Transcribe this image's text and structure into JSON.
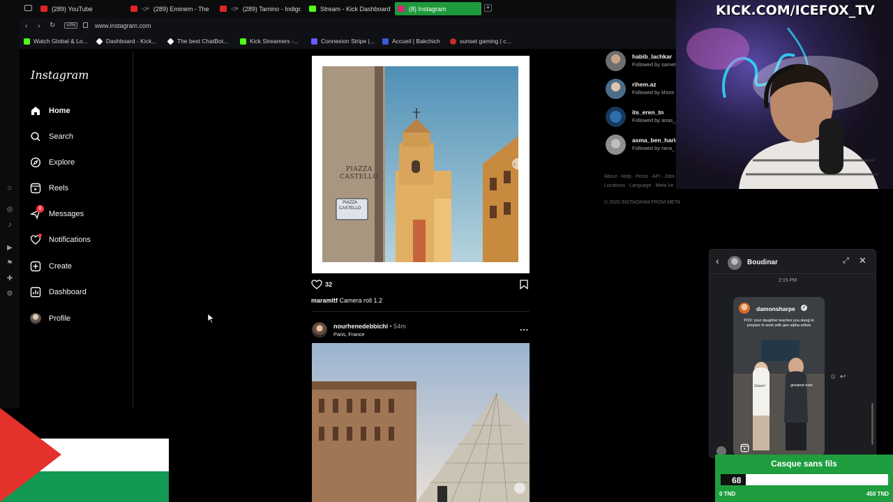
{
  "browser": {
    "tabs": [
      {
        "label": "(289) YouTube",
        "color": "#e02424"
      },
      {
        "label": "(289) Eminem - The F",
        "color": "#e02424"
      },
      {
        "label": "(289) Tamino - Indigo",
        "color": "#e02424"
      },
      {
        "label": "Stream - Kick Dashboard",
        "color": "#53fc18"
      },
      {
        "label": "(8) Instagram",
        "color": "#d62976"
      }
    ],
    "new_tab": "+",
    "vpn_badge": "VPN",
    "url": "www.instagram.com",
    "bookmarks": [
      {
        "label": "Watch Global & Lo...",
        "color": "#53fc18"
      },
      {
        "label": "Dashboard - Kick...",
        "color": "#ffffff"
      },
      {
        "label": "The best ChatBot...",
        "color": "#ffffff"
      },
      {
        "label": "Kick Streamers -...",
        "color": "#53fc18"
      },
      {
        "label": "Connexion Stripe |...",
        "color": "#635bff"
      },
      {
        "label": "Accueil | Bakchich",
        "color": "#3b5bdb"
      },
      {
        "label": "sunset gaming | c...",
        "color": "#c92a2a"
      }
    ]
  },
  "instagram": {
    "logo": "Instagram",
    "nav": [
      {
        "label": "Home",
        "icon": "home-icon"
      },
      {
        "label": "Search",
        "icon": "search-icon"
      },
      {
        "label": "Explore",
        "icon": "explore-icon"
      },
      {
        "label": "Reels",
        "icon": "reels-icon"
      },
      {
        "label": "Messages",
        "icon": "messages-icon",
        "badge": "8"
      },
      {
        "label": "Notifications",
        "icon": "heart-icon"
      },
      {
        "label": "Create",
        "icon": "create-icon"
      },
      {
        "label": "Dashboard",
        "icon": "dashboard-icon"
      },
      {
        "label": "Profile",
        "icon": "avatar"
      }
    ],
    "post1": {
      "likes": "32",
      "username": "maramltf",
      "caption": "Camera roll 1.2",
      "sign_1": "PIAZZA\nCASTELLO",
      "sign_2": "PIAZZA\nCASTELLO"
    },
    "post2": {
      "username": "nourhenedebbichi",
      "time": "• 54m",
      "location": "Paris, France",
      "more": "..."
    },
    "suggestions": [
      {
        "name": "habib_lachkar",
        "sub": "Followed by samet"
      },
      {
        "name": "rihem.az",
        "sub": "Followed by khom"
      },
      {
        "name": "its_eren_tn",
        "sub": "Followed by anas_"
      },
      {
        "name": "asma_ben_haris",
        "sub": "Followed by rana_"
      }
    ],
    "footer_line1": "About · Help · Press · API · Jobs",
    "footer_line2": "Locations · Language · Meta Ve",
    "copyright": "© 2025 INSTAGRAM FROM META"
  },
  "overlay": {
    "channel": "KICK.COM/ICEFOX_TV",
    "chat": {
      "contact": "Boudinar",
      "time": "2:15 PM",
      "reel_author": "damonsharpe",
      "reel_caption": "POV: your daughter teaches you slang to prepare to work with gen alpha artists",
      "reel_tag_left": "Glazin'",
      "reel_tag_right": "greatest ever"
    },
    "goal": {
      "title": "Casque sans fils",
      "current": "68",
      "min": "0 TND",
      "max": "450 TND",
      "progress": 0.151
    }
  }
}
